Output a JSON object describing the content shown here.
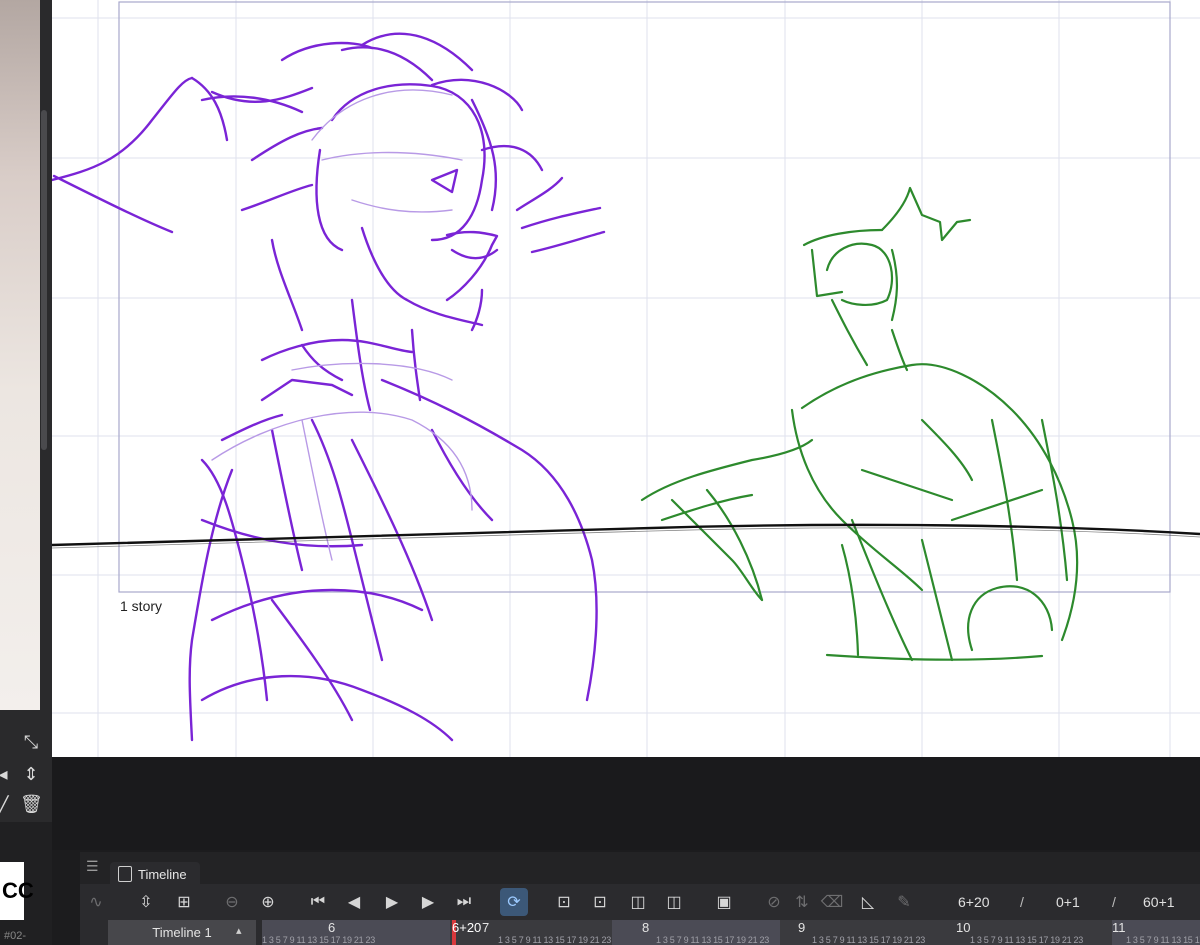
{
  "canvas": {
    "story_label": "1 story",
    "stroke_colors": {
      "character_left": "#7a24d6",
      "character_right": "#2d8a2d",
      "ground_line": "#111111",
      "construction": "#b89ae6"
    }
  },
  "left_panel": {
    "logo_text": "CC",
    "code_text": "#02-",
    "icons": [
      "transform-icon",
      "arrow-left-icon",
      "distribute-vertical-icon",
      "pen-icon",
      "trash-icon"
    ]
  },
  "timeline": {
    "tab_label": "Timeline",
    "track_name": "Timeline 1",
    "current_frame": "6+20",
    "start_frame": "0+1",
    "end_frame": "60+1",
    "separator": "/",
    "ruler": {
      "playhead_label": "6+20",
      "major_labels": [
        "6",
        "7",
        "8",
        "9",
        "10",
        "11"
      ],
      "minor_sequence": "1 3 5 7 9 11 13 15 17 19 21 23"
    },
    "toolbar_icons": [
      "graph-editor-icon",
      "fit-timeline-icon",
      "add-keyframe-icon",
      "zoom-out-icon",
      "zoom-in-icon",
      "go-to-start-icon",
      "previous-frame-icon",
      "play-icon",
      "next-frame-icon",
      "go-to-end-icon",
      "loop-icon",
      "new-cel-icon",
      "new-layer-cel-icon",
      "onion-skin-icon",
      "onion-skin-settings-icon",
      "light-table-icon",
      "enable-timing-icon",
      "arrange-cels-icon",
      "clear-cel-icon",
      "lasso-fill-icon",
      "pen-disabled-icon"
    ]
  }
}
